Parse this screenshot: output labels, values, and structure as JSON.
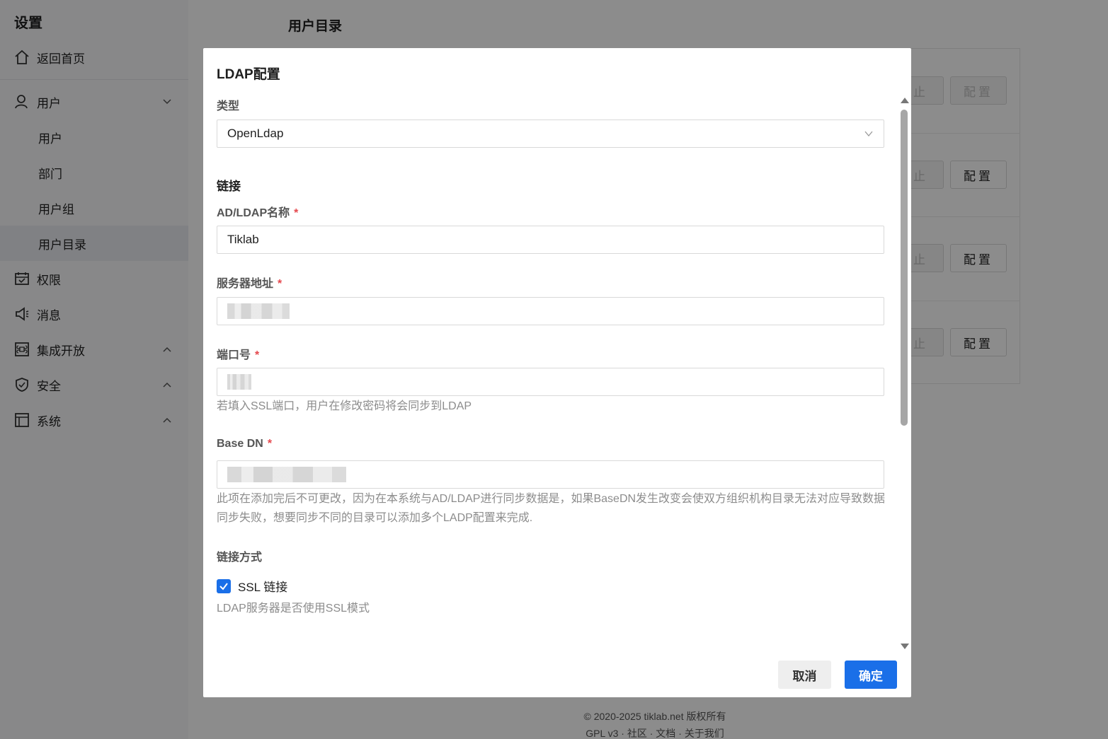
{
  "sidebar": {
    "title": "设置",
    "home": "返回首页",
    "items": [
      {
        "label": "用户"
      },
      {
        "label": "用户"
      },
      {
        "label": "部门"
      },
      {
        "label": "用户组"
      },
      {
        "label": "用户目录"
      },
      {
        "label": "权限"
      },
      {
        "label": "消息"
      },
      {
        "label": "集成开放"
      },
      {
        "label": "安全"
      },
      {
        "label": "系统"
      }
    ]
  },
  "page": {
    "title": "用户目录",
    "row_buttons": {
      "stop": "禁止",
      "config": "配置"
    }
  },
  "footer": {
    "copyright": "© 2020-2025 tiklab.net 版权所有",
    "links": "GPL v3 · 社区 · 文档 · 关于我们"
  },
  "modal": {
    "title": "LDAP配置",
    "type_label": "类型",
    "type_value": "OpenLdap",
    "section_link": "链接",
    "name_label": "AD/LDAP名称",
    "name_value": "Tiklab",
    "server_label": "服务器地址",
    "port_label": "端口号",
    "port_hint": "若填入SSL端口，用户在修改密码将会同步到LDAP",
    "basedn_label": "Base DN",
    "basedn_hint": "此项在添加完后不可更改，因为在本系统与AD/LDAP进行同步数据是，如果BaseDN发生改变会使双方组织机构目录无法对应导致数据同步失败，想要同步不同的目录可以添加多个LADP配置来完成.",
    "link_mode_label": "链接方式",
    "ssl_label": "SSL 链接",
    "ssl_checked": true,
    "ssl_hint": "LDAP服务器是否使用SSL模式",
    "required_mark": "*",
    "cancel": "取消",
    "confirm": "确定"
  },
  "colors": {
    "primary": "#1a6fe8",
    "required": "#e5484d"
  }
}
